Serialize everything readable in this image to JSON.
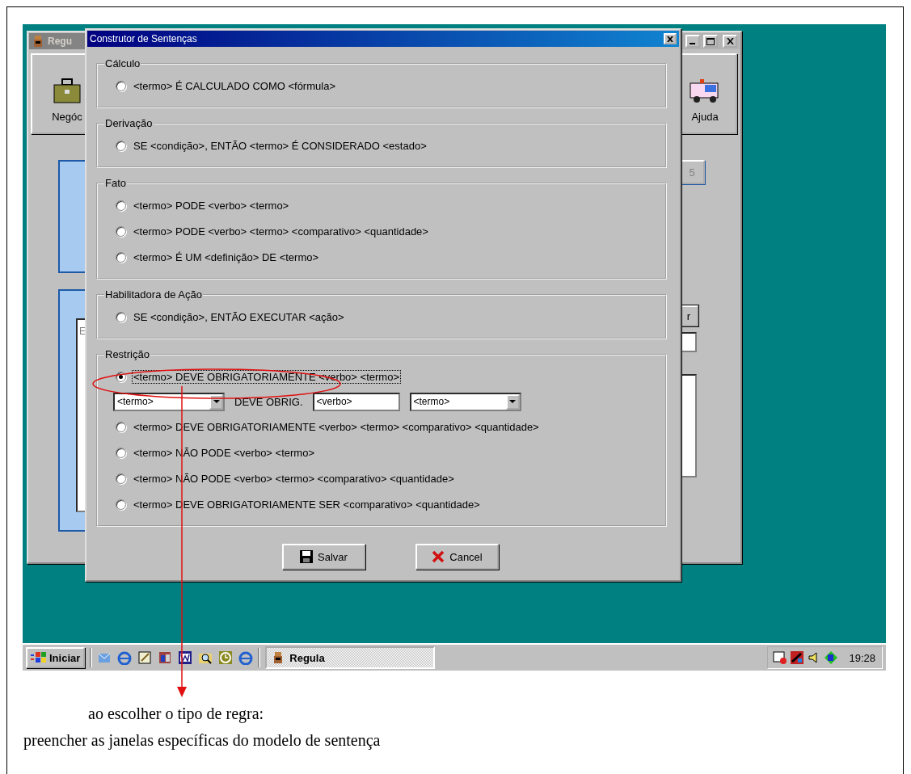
{
  "background_window": {
    "title": "Regu",
    "toolbar": [
      {
        "label": "Negóc"
      },
      {
        "label": "Ajuda"
      }
    ],
    "page_button": "5",
    "side_button": "r",
    "list_text": "E"
  },
  "dialog": {
    "title": "Construtor de Sentenças",
    "groups": [
      {
        "title": "Cálculo",
        "options": [
          {
            "label": "<termo> É CALCULADO COMO <fórmula>",
            "selected": false
          }
        ]
      },
      {
        "title": "Derivação",
        "options": [
          {
            "label": "SE <condição>, ENTÃO <termo> É CONSIDERADO <estado>",
            "selected": false
          }
        ]
      },
      {
        "title": "Fato",
        "options": [
          {
            "label": "<termo> PODE <verbo> <termo>",
            "selected": false
          },
          {
            "label": "<termo> PODE <verbo> <termo> <comparativo> <quantidade>",
            "selected": false
          },
          {
            "label": "<termo> É UM <definição> DE <termo>",
            "selected": false
          }
        ]
      },
      {
        "title": "Habilitadora de Ação",
        "options": [
          {
            "label": "SE <condição>, ENTÃO EXECUTAR <ação>",
            "selected": false
          }
        ]
      },
      {
        "title": "Restrição",
        "options": [
          {
            "label": "<termo> DEVE OBRIGATORIAMENTE <verbo> <termo>",
            "selected": true,
            "fields": [
              {
                "kind": "dropdown",
                "value": "<termo>"
              },
              {
                "kind": "label",
                "text": "DEVE OBRIG."
              },
              {
                "kind": "input",
                "value": "<verbo>"
              },
              {
                "kind": "dropdown",
                "value": "<termo>"
              }
            ]
          },
          {
            "label": "<termo> DEVE OBRIGATORIAMENTE <verbo> <termo> <comparativo> <quantidade>",
            "selected": false
          },
          {
            "label": "<termo> NÃO PODE <verbo> <termo>",
            "selected": false
          },
          {
            "label": "<termo> NÃO PODE <verbo> <termo> <comparativo> <quantidade>",
            "selected": false
          },
          {
            "label": "<termo> DEVE OBRIGATORIAMENTE SER <comparativo> <quantidade>",
            "selected": false
          }
        ]
      }
    ],
    "buttons": [
      {
        "kind": "save",
        "label": "Salvar"
      },
      {
        "kind": "cancel",
        "label": "Cancel"
      }
    ]
  },
  "taskbar": {
    "start": "Iniciar",
    "tasks": [
      {
        "label": "Regula",
        "selected": true
      }
    ],
    "clock": "19:28"
  },
  "caption": [
    "ao escolher o tipo de regra:",
    "preencher as janelas específicas do modelo de sentença"
  ]
}
